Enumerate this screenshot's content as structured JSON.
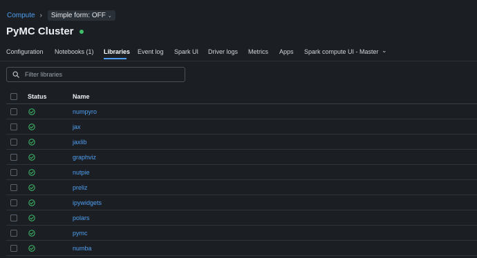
{
  "breadcrumb": {
    "root": "Compute",
    "separator": "›",
    "simple_form": "Simple form: OFF",
    "simple_form_caret": "⌄"
  },
  "page": {
    "title": "PyMC Cluster",
    "status_color": "#3fbf6a"
  },
  "tabs": [
    {
      "label": "Configuration",
      "active": false
    },
    {
      "label": "Notebooks (1)",
      "active": false
    },
    {
      "label": "Libraries",
      "active": true
    },
    {
      "label": "Event log",
      "active": false
    },
    {
      "label": "Spark UI",
      "active": false
    },
    {
      "label": "Driver logs",
      "active": false
    },
    {
      "label": "Metrics",
      "active": false
    },
    {
      "label": "Apps",
      "active": false
    },
    {
      "label": "Spark compute UI - Master",
      "active": false
    }
  ],
  "tabs_more_caret": "⌄",
  "search": {
    "placeholder": "Filter libraries",
    "value": ""
  },
  "table": {
    "headers": {
      "status": "Status",
      "name": "Name"
    },
    "rows": [
      {
        "name": "numpyro",
        "status": "installed"
      },
      {
        "name": "jax",
        "status": "installed"
      },
      {
        "name": "jaxlib",
        "status": "installed"
      },
      {
        "name": "graphviz",
        "status": "installed"
      },
      {
        "name": "nutpie",
        "status": "installed"
      },
      {
        "name": "preliz",
        "status": "installed"
      },
      {
        "name": "ipywidgets",
        "status": "installed"
      },
      {
        "name": "polars",
        "status": "installed"
      },
      {
        "name": "pymc",
        "status": "installed"
      },
      {
        "name": "numba",
        "status": "installed"
      }
    ]
  },
  "colors": {
    "accent": "#4f9ff0",
    "success": "#3fbf6a",
    "background": "#1b1f24"
  },
  "icons": {
    "status_ok": "check-circle-icon",
    "search": "search-icon"
  }
}
